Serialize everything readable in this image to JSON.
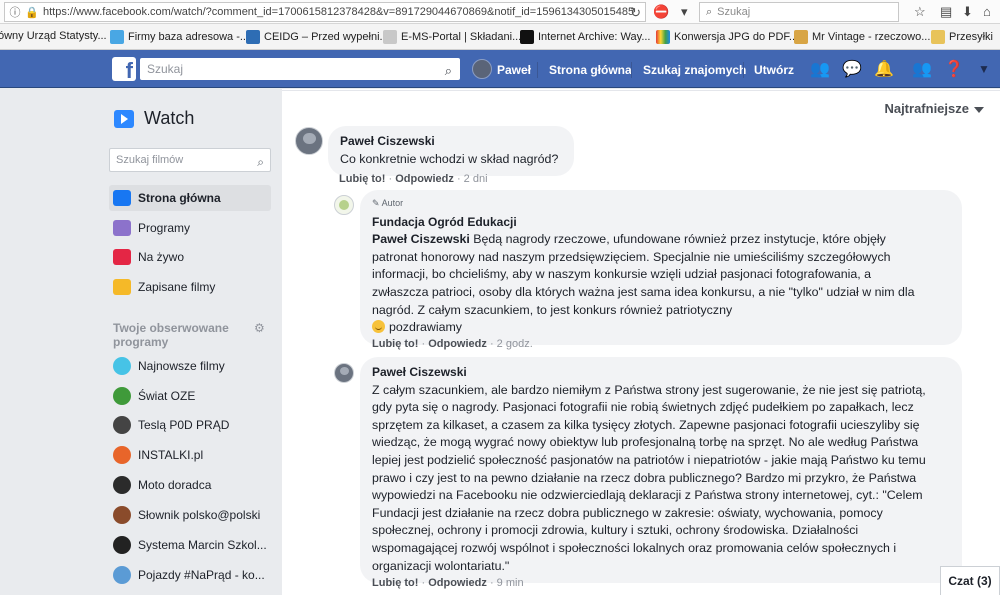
{
  "browser": {
    "url": "https://www.facebook.com/watch/?comment_id=1700615812378428&v=891729044670869&notif_id=1596134305015485",
    "search_placeholder": "Szukaj",
    "bookmarks": [
      "ówny Urząd Statysty...",
      "Firmy baza adresowa -...",
      "CEIDG – Przed wypełni...",
      "E-MS-Portal | Składani...",
      "Internet Archive: Way...",
      "Konwersja JPG do PDF...",
      "Mr Vintage - rzeczowo...",
      "Przesyłki"
    ]
  },
  "fb_header": {
    "logo": "f",
    "search_placeholder": "Szukaj",
    "user": "Paweł",
    "home": "Strona główna",
    "find_friends": "Szukaj znajomych",
    "create": "Utwórz"
  },
  "sidebar": {
    "title": "Watch",
    "search_placeholder": "Szukaj filmów",
    "nav": [
      {
        "label": "Strona główna",
        "color": "#1877f2"
      },
      {
        "label": "Programy",
        "color": "#8c72cb"
      },
      {
        "label": "Na żywo",
        "color": "#e42645"
      },
      {
        "label": "Zapisane filmy",
        "color": "#f5b928"
      }
    ],
    "followed_heading": "Twoje obserwowane programy",
    "programs": [
      {
        "label": "Najnowsze filmy",
        "color": "#46c3e6"
      },
      {
        "label": "Świat OZE",
        "color": "#3f9a3a"
      },
      {
        "label": "Teslą P0D PRĄD",
        "color": "#444444"
      },
      {
        "label": "INSTALKI.pl",
        "color": "#e8652a"
      },
      {
        "label": "Moto doradca",
        "color": "#2b2b2b"
      },
      {
        "label": "Słownik polsko@polski",
        "color": "#8a4b2b"
      },
      {
        "label": "Systema Marcin Szkol...",
        "color": "#222222"
      },
      {
        "label": "Pojazdy #NaPrąd - ko...",
        "color": "#5b9bd5"
      }
    ]
  },
  "main": {
    "sort_label": "Najtrafniejsze",
    "comments": [
      {
        "author": "Paweł Ciszewski",
        "text": "Co konkretnie wchodzi w skład nagród?",
        "like": "Lubię to!",
        "reply": "Odpowiedz",
        "time": "2 dni"
      },
      {
        "badge": "Autor",
        "author": "Fundacja Ogród Edukacji",
        "mention": "Paweł Ciszewski",
        "lines": [
          "Będą nagrody rzeczowe, ufundowane również przez instytucje, które objęły",
          "patronat honorowy nad naszym przedsięwzięciem. Specjalnie nie umieściliśmy szczegółowych",
          "informacji, bo chcieliśmy, aby w naszym konkursie wzięli udział pasjonaci fotografowania, a",
          "zwłaszcza patrioci, osoby dla których ważna jest sama idea konkursu, a nie \"tylko\" udział w nim dla",
          "nagród. Z całym szacunkiem, to jest konkurs również patriotyczny"
        ],
        "signoff": "pozdrawiamy",
        "like": "Lubię to!",
        "reply": "Odpowiedz",
        "time": "2 godz."
      },
      {
        "author": "Paweł Ciszewski",
        "lines": [
          "Z całym szacunkiem, ale bardzo niemiłym z Państwa strony jest sugerowanie, że nie jest się patriotą,",
          "gdy pyta się o nagrody. Pasjonaci fotografii nie robią świetnych zdjęć pudełkiem po zapałkach, lecz",
          "sprzętem za kilkaset, a czasem za kilka tysięcy złotych. Zapewne pasjonaci fotografii ucieszyliby się",
          "wiedząc, że mogą wygrać nowy obiektyw lub profesjonalną torbę na sprzęt. No ale według Państwa",
          "lepiej jest podzielić społeczność pasjonatów na patriotów i niepatriotów - jakie mają Państwo ku temu",
          "prawo i czy jest to na pewno działanie na rzecz dobra publicznego? Bardzo mi przykro, że Państwa",
          "wypowiedzi na Facebooku nie odzwierciedlają deklaracji z Państwa strony internetowej, cyt.: \"Celem",
          "Fundacji jest działanie na rzecz dobra publicznego w zakresie: oświaty, wychowania, pomocy",
          "społecznej, ochrony i promocji zdrowia, kultury i sztuki, ochrony środowiska. Działalności",
          "wspomagającej rozwój wspólnot i społeczności lokalnych oraz promowania celów społecznych i",
          "organizacji wolontariatu.\""
        ],
        "like": "Lubię to!",
        "reply": "Odpowiedz",
        "time": "9 min"
      }
    ]
  },
  "chat": {
    "label": "Czat (3)"
  }
}
